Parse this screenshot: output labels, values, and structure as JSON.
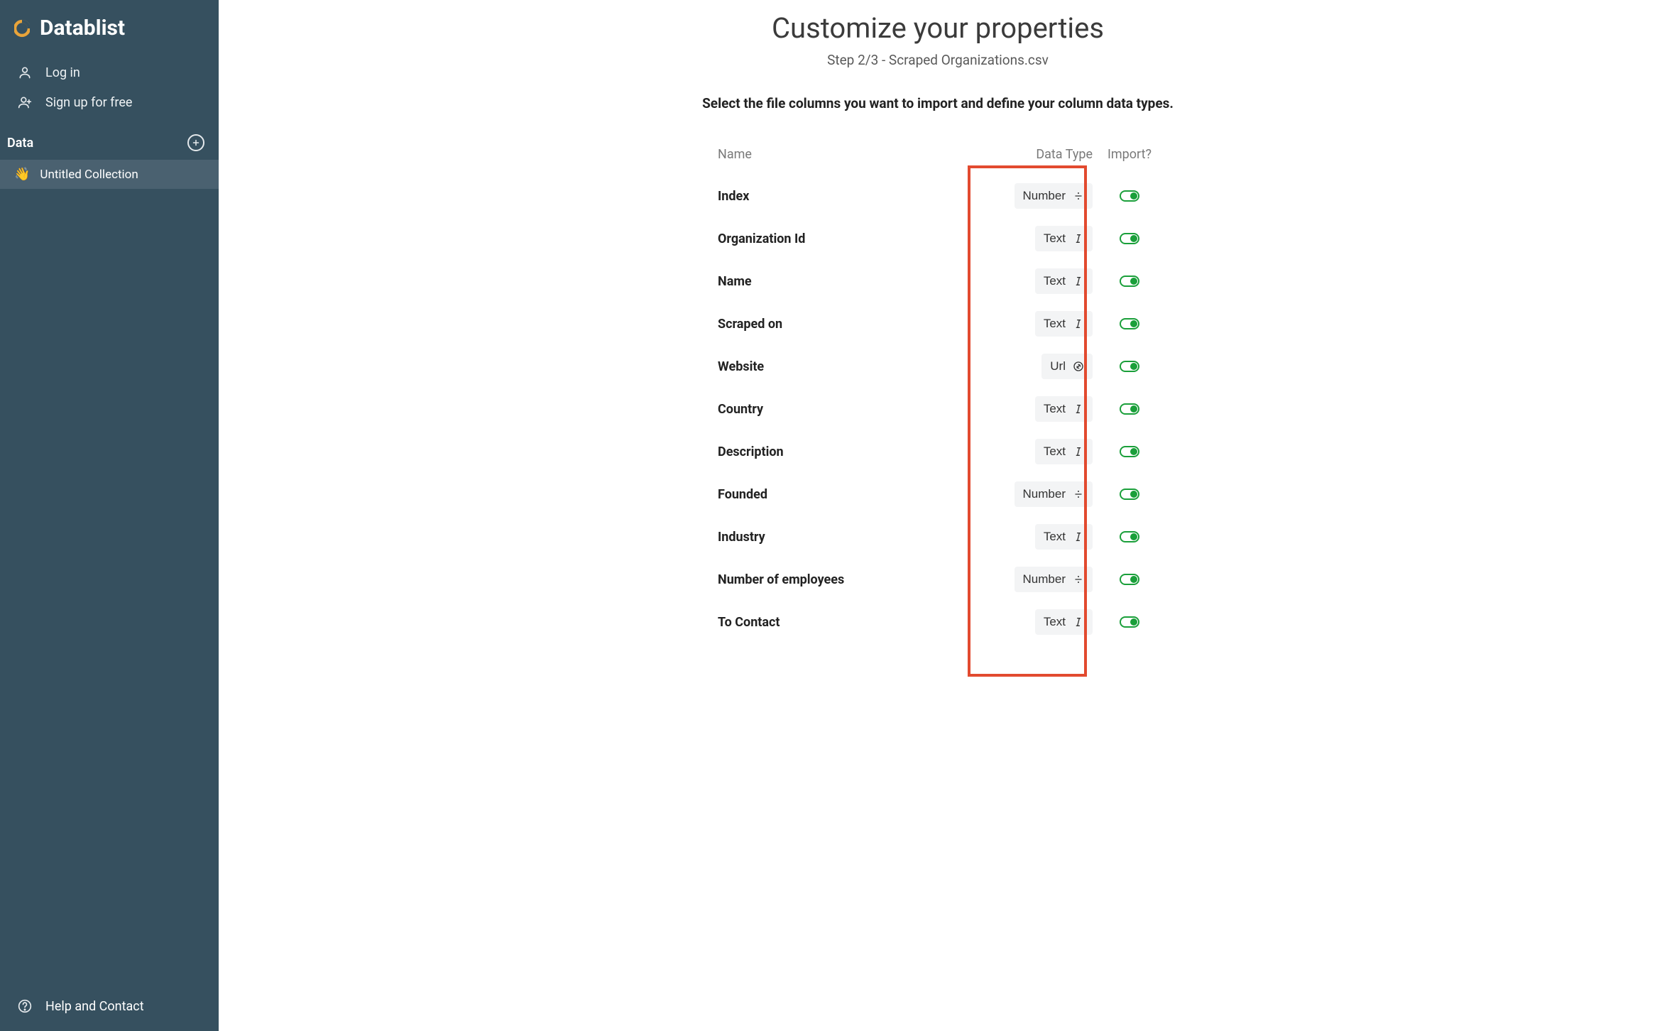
{
  "brand": {
    "name": "Datablist"
  },
  "sidebar": {
    "nav": [
      {
        "label": "Log in",
        "name": "login"
      },
      {
        "label": "Sign up for free",
        "name": "signup"
      }
    ],
    "section_label": "Data",
    "collections": [
      {
        "emoji": "👋",
        "label": "Untitled Collection",
        "name": "untitled-collection"
      }
    ],
    "help_label": "Help and Contact"
  },
  "page": {
    "title": "Customize your properties",
    "step_text": "Step 2/3 - Scraped Organizations.csv",
    "instruction": "Select the file columns you want to import and define your column data types."
  },
  "table": {
    "headers": {
      "name": "Name",
      "data_type": "Data Type",
      "import": "Import?"
    },
    "rows": [
      {
        "name": "Index",
        "type": "Number",
        "type_icon": "number",
        "import": true
      },
      {
        "name": "Organization Id",
        "type": "Text",
        "type_icon": "text",
        "import": true
      },
      {
        "name": "Name",
        "type": "Text",
        "type_icon": "text",
        "import": true
      },
      {
        "name": "Scraped on",
        "type": "Text",
        "type_icon": "text",
        "import": true
      },
      {
        "name": "Website",
        "type": "Url",
        "type_icon": "url",
        "import": true
      },
      {
        "name": "Country",
        "type": "Text",
        "type_icon": "text",
        "import": true
      },
      {
        "name": "Description",
        "type": "Text",
        "type_icon": "text",
        "import": true
      },
      {
        "name": "Founded",
        "type": "Number",
        "type_icon": "number",
        "import": true
      },
      {
        "name": "Industry",
        "type": "Text",
        "type_icon": "text",
        "import": true
      },
      {
        "name": "Number of employees",
        "type": "Number",
        "type_icon": "number",
        "import": true
      },
      {
        "name": "To Contact",
        "type": "Text",
        "type_icon": "text",
        "import": true
      }
    ]
  }
}
